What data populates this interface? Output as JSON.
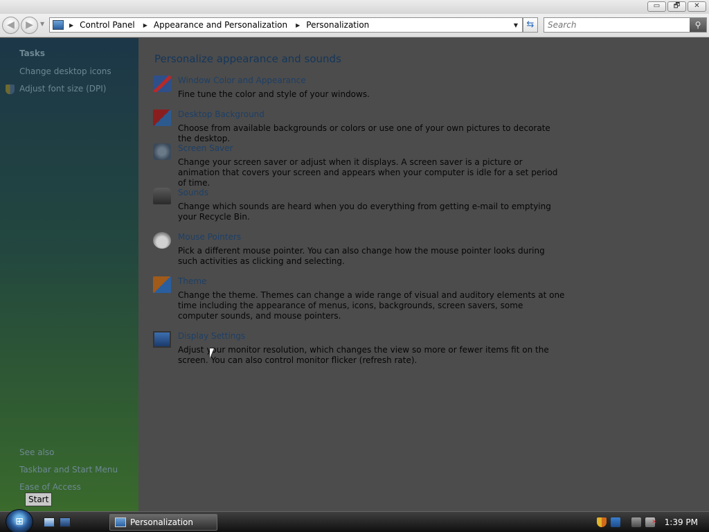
{
  "window": {
    "controls": {
      "minimize": "▭",
      "maximize": "🗗",
      "close": "✕"
    }
  },
  "address_bar": {
    "breadcrumbs": [
      "Control Panel",
      "Appearance and Personalization",
      "Personalization"
    ],
    "search_placeholder": "Search"
  },
  "sidebar": {
    "tasks_heading": "Tasks",
    "tasks": [
      "Change desktop icons",
      "Adjust font size (DPI)"
    ],
    "see_also_heading": "See also",
    "see_also": [
      "Taskbar and Start Menu",
      "Ease of Access"
    ],
    "tooltip": "Start"
  },
  "main": {
    "title": "Personalize appearance and sounds",
    "items": [
      {
        "icon": "window-color-icon",
        "label": "Window Color and Appearance",
        "description": "Fine tune the color and style of your windows."
      },
      {
        "icon": "desktop-background-icon",
        "label": "Desktop Background",
        "description": "Choose from available backgrounds or colors or use one of your own pictures to decorate the desktop."
      },
      {
        "icon": "screen-saver-icon",
        "label": "Screen Saver",
        "description": "Change your screen saver or adjust when it displays. A screen saver is a picture or animation that covers your screen and appears when your computer is idle for a set period of time."
      },
      {
        "icon": "sounds-icon",
        "label": "Sounds",
        "description": "Change which sounds are heard when you do everything from getting e-mail to emptying your Recycle Bin."
      },
      {
        "icon": "mouse-pointer-icon",
        "label": "Mouse Pointers",
        "description": "Pick a different mouse pointer. You can also change how the mouse pointer looks during such activities as clicking and selecting."
      },
      {
        "icon": "theme-icon",
        "label": "Theme",
        "description": "Change the theme. Themes can change a wide range of visual and auditory elements at one time including the appearance of menus, icons, backgrounds, screen savers, some computer sounds, and mouse pointers."
      },
      {
        "icon": "display-settings-icon",
        "label": "Display Settings",
        "description": "Adjust your monitor resolution, which changes the view so more or fewer items fit on the screen. You can also control monitor flicker (refresh rate)."
      }
    ]
  },
  "taskbar": {
    "active_window": "Personalization",
    "clock": "1:39 PM"
  },
  "colors": {
    "link": "#1d3f66",
    "main_bg": "#4c4c4c",
    "sidebar_top": "#1c3748",
    "sidebar_bottom": "#3a6a2c"
  }
}
